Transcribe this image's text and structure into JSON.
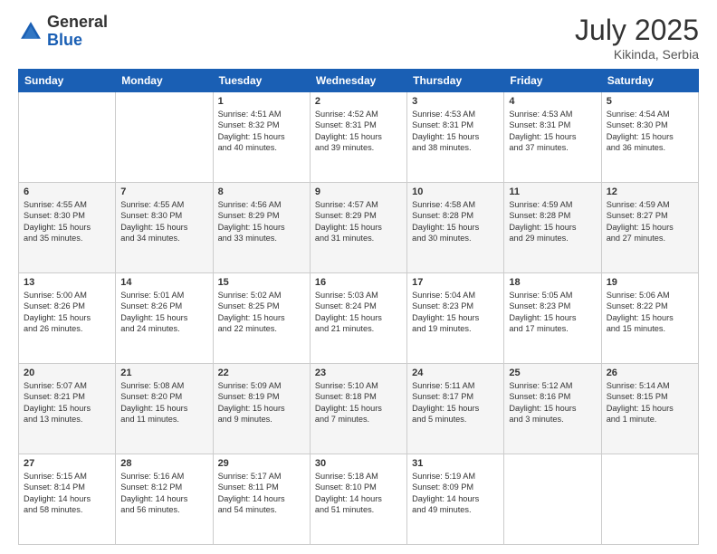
{
  "header": {
    "logo_general": "General",
    "logo_blue": "Blue",
    "month": "July 2025",
    "location": "Kikinda, Serbia"
  },
  "days_of_week": [
    "Sunday",
    "Monday",
    "Tuesday",
    "Wednesday",
    "Thursday",
    "Friday",
    "Saturday"
  ],
  "weeks": [
    [
      {
        "day": "",
        "info": ""
      },
      {
        "day": "",
        "info": ""
      },
      {
        "day": "1",
        "info": "Sunrise: 4:51 AM\nSunset: 8:32 PM\nDaylight: 15 hours\nand 40 minutes."
      },
      {
        "day": "2",
        "info": "Sunrise: 4:52 AM\nSunset: 8:31 PM\nDaylight: 15 hours\nand 39 minutes."
      },
      {
        "day": "3",
        "info": "Sunrise: 4:53 AM\nSunset: 8:31 PM\nDaylight: 15 hours\nand 38 minutes."
      },
      {
        "day": "4",
        "info": "Sunrise: 4:53 AM\nSunset: 8:31 PM\nDaylight: 15 hours\nand 37 minutes."
      },
      {
        "day": "5",
        "info": "Sunrise: 4:54 AM\nSunset: 8:30 PM\nDaylight: 15 hours\nand 36 minutes."
      }
    ],
    [
      {
        "day": "6",
        "info": "Sunrise: 4:55 AM\nSunset: 8:30 PM\nDaylight: 15 hours\nand 35 minutes."
      },
      {
        "day": "7",
        "info": "Sunrise: 4:55 AM\nSunset: 8:30 PM\nDaylight: 15 hours\nand 34 minutes."
      },
      {
        "day": "8",
        "info": "Sunrise: 4:56 AM\nSunset: 8:29 PM\nDaylight: 15 hours\nand 33 minutes."
      },
      {
        "day": "9",
        "info": "Sunrise: 4:57 AM\nSunset: 8:29 PM\nDaylight: 15 hours\nand 31 minutes."
      },
      {
        "day": "10",
        "info": "Sunrise: 4:58 AM\nSunset: 8:28 PM\nDaylight: 15 hours\nand 30 minutes."
      },
      {
        "day": "11",
        "info": "Sunrise: 4:59 AM\nSunset: 8:28 PM\nDaylight: 15 hours\nand 29 minutes."
      },
      {
        "day": "12",
        "info": "Sunrise: 4:59 AM\nSunset: 8:27 PM\nDaylight: 15 hours\nand 27 minutes."
      }
    ],
    [
      {
        "day": "13",
        "info": "Sunrise: 5:00 AM\nSunset: 8:26 PM\nDaylight: 15 hours\nand 26 minutes."
      },
      {
        "day": "14",
        "info": "Sunrise: 5:01 AM\nSunset: 8:26 PM\nDaylight: 15 hours\nand 24 minutes."
      },
      {
        "day": "15",
        "info": "Sunrise: 5:02 AM\nSunset: 8:25 PM\nDaylight: 15 hours\nand 22 minutes."
      },
      {
        "day": "16",
        "info": "Sunrise: 5:03 AM\nSunset: 8:24 PM\nDaylight: 15 hours\nand 21 minutes."
      },
      {
        "day": "17",
        "info": "Sunrise: 5:04 AM\nSunset: 8:23 PM\nDaylight: 15 hours\nand 19 minutes."
      },
      {
        "day": "18",
        "info": "Sunrise: 5:05 AM\nSunset: 8:23 PM\nDaylight: 15 hours\nand 17 minutes."
      },
      {
        "day": "19",
        "info": "Sunrise: 5:06 AM\nSunset: 8:22 PM\nDaylight: 15 hours\nand 15 minutes."
      }
    ],
    [
      {
        "day": "20",
        "info": "Sunrise: 5:07 AM\nSunset: 8:21 PM\nDaylight: 15 hours\nand 13 minutes."
      },
      {
        "day": "21",
        "info": "Sunrise: 5:08 AM\nSunset: 8:20 PM\nDaylight: 15 hours\nand 11 minutes."
      },
      {
        "day": "22",
        "info": "Sunrise: 5:09 AM\nSunset: 8:19 PM\nDaylight: 15 hours\nand 9 minutes."
      },
      {
        "day": "23",
        "info": "Sunrise: 5:10 AM\nSunset: 8:18 PM\nDaylight: 15 hours\nand 7 minutes."
      },
      {
        "day": "24",
        "info": "Sunrise: 5:11 AM\nSunset: 8:17 PM\nDaylight: 15 hours\nand 5 minutes."
      },
      {
        "day": "25",
        "info": "Sunrise: 5:12 AM\nSunset: 8:16 PM\nDaylight: 15 hours\nand 3 minutes."
      },
      {
        "day": "26",
        "info": "Sunrise: 5:14 AM\nSunset: 8:15 PM\nDaylight: 15 hours\nand 1 minute."
      }
    ],
    [
      {
        "day": "27",
        "info": "Sunrise: 5:15 AM\nSunset: 8:14 PM\nDaylight: 14 hours\nand 58 minutes."
      },
      {
        "day": "28",
        "info": "Sunrise: 5:16 AM\nSunset: 8:12 PM\nDaylight: 14 hours\nand 56 minutes."
      },
      {
        "day": "29",
        "info": "Sunrise: 5:17 AM\nSunset: 8:11 PM\nDaylight: 14 hours\nand 54 minutes."
      },
      {
        "day": "30",
        "info": "Sunrise: 5:18 AM\nSunset: 8:10 PM\nDaylight: 14 hours\nand 51 minutes."
      },
      {
        "day": "31",
        "info": "Sunrise: 5:19 AM\nSunset: 8:09 PM\nDaylight: 14 hours\nand 49 minutes."
      },
      {
        "day": "",
        "info": ""
      },
      {
        "day": "",
        "info": ""
      }
    ]
  ]
}
